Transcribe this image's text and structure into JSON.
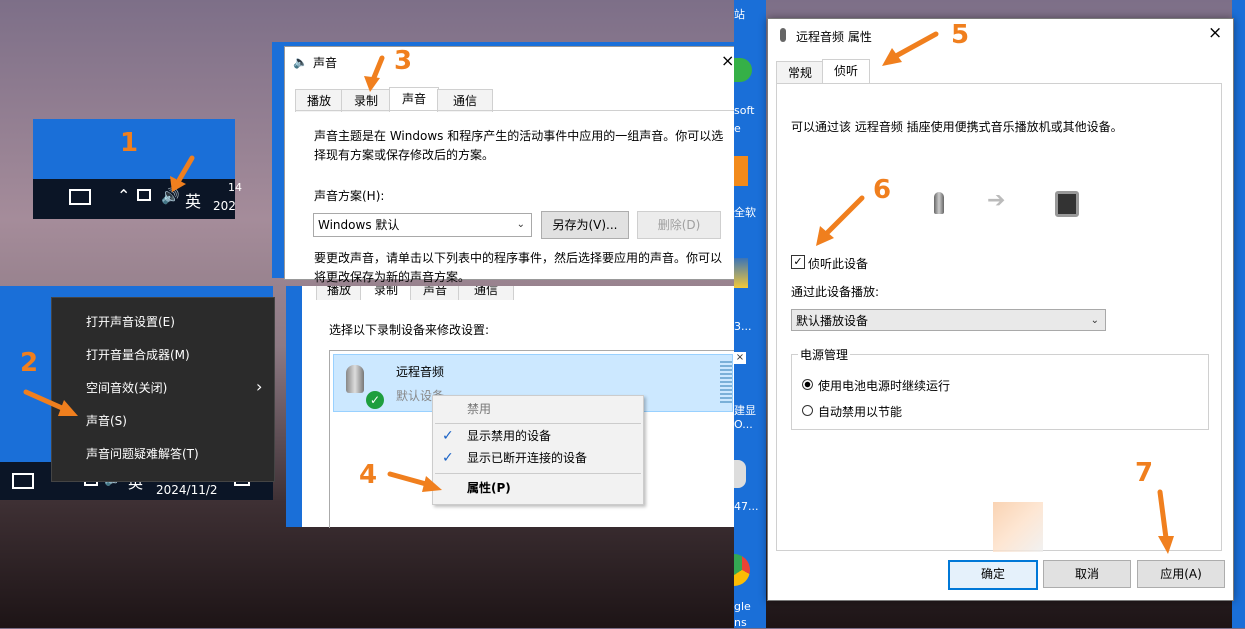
{
  "annotations": {
    "n1": "1",
    "n2": "2",
    "n3": "3",
    "n4": "4",
    "n5": "5",
    "n6": "6",
    "n7": "7"
  },
  "taskbar1": {
    "ime": "英",
    "time_partial": "14",
    "date_partial": "202"
  },
  "tray_menu": {
    "items": [
      "打开声音设置(E)",
      "打开音量合成器(M)",
      "空间音效(关闭)",
      "声音(S)",
      "声音问题疑难解答(T)"
    ],
    "submenu_arrow": "›"
  },
  "taskbar2": {
    "ime": "英",
    "date": "2024/11/2"
  },
  "sound_dialog": {
    "title": "声音",
    "close": "×",
    "tabs": [
      "播放",
      "录制",
      "声音",
      "通信"
    ],
    "active_tab": "声音",
    "desc1": "声音主题是在 Windows 和程序产生的活动事件中应用的一组声音。你可以选择现有方案或保存修改后的方案。",
    "scheme_label": "声音方案(H):",
    "scheme_value": "Windows 默认",
    "save_as": "另存为(V)...",
    "delete": "删除(D)",
    "desc2": "要更改声音，请单击以下列表中的程序事件，然后选择要应用的声音。你可以将更改保存为新的声音方案。"
  },
  "record_panel": {
    "tabs": [
      "播放",
      "录制",
      "声音",
      "通信"
    ],
    "instruction": "选择以下录制设备来修改设置:",
    "device_name": "远程音频",
    "device_sub": "默认设备",
    "ctx": {
      "disable": "禁用",
      "show_disabled": "显示禁用的设备",
      "show_disconnected": "显示已断开连接的设备",
      "properties": "属性(P)"
    }
  },
  "desktop_icons": [
    "站",
    "soft",
    "e",
    "全软",
    "3...",
    "建显",
    "O...",
    "47...",
    "gle",
    "ns"
  ],
  "props_dialog": {
    "title": "远程音频 属性",
    "close": "×",
    "tabs": [
      "常规",
      "侦听"
    ],
    "active_tab": "侦听",
    "desc": "可以通过该 远程音频 插座使用便携式音乐播放机或其他设备。",
    "listen_check": "侦听此设备",
    "play_via_label": "通过此设备播放:",
    "play_via_value": "默认播放设备",
    "power_group": "电源管理",
    "radio1": "使用电池电源时继续运行",
    "radio2": "自动禁用以节能",
    "ok": "确定",
    "cancel": "取消",
    "apply": "应用(A)"
  },
  "colors": {
    "accent_orange": "#f07f1e",
    "win_blue": "#0078d7",
    "select_blue": "#cce8ff"
  }
}
